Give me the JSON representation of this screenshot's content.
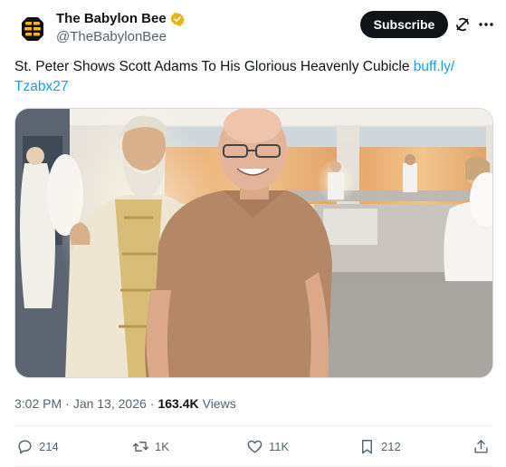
{
  "account": {
    "display_name": "The Babylon Bee",
    "handle": "@TheBabylonBee",
    "verified": true,
    "avatar_icon": "bee-logo-icon",
    "avatar_bg": "#111111",
    "avatar_color": "#f5a623"
  },
  "header": {
    "subscribe_label": "Subscribe",
    "grok_icon": "grok-icon",
    "more_icon": "more-icon"
  },
  "tweet": {
    "text": "St. Peter Shows Scott Adams To His Glorious Heavenly Cubicle ",
    "link_text": "buff.ly/\nTzabx27",
    "link_line1": "buff.ly/",
    "link_line2": "Tzabx27"
  },
  "meta": {
    "time": "3:02 PM",
    "separator": "·",
    "date": "Jan 13, 2026",
    "views_count": "163.4K",
    "views_label": "Views"
  },
  "actions": {
    "replies": "214",
    "reposts": "1K",
    "likes": "11K",
    "bookmarks": "212"
  },
  "colors": {
    "link": "#1d9bf0",
    "verified": "#e2b719",
    "secondary_text": "#536471"
  }
}
